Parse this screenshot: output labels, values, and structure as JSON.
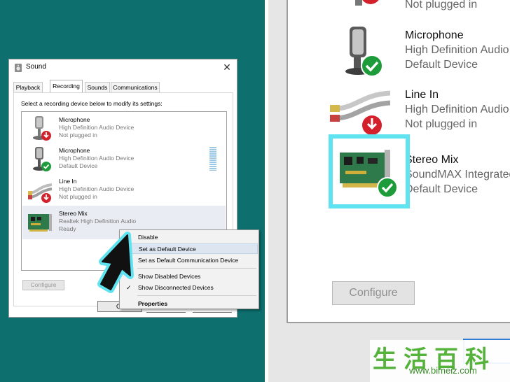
{
  "dialog": {
    "title": "Sound",
    "tabs": [
      "Playback",
      "Recording",
      "Sounds",
      "Communications"
    ],
    "active_tab": "Recording",
    "instruction": "Select a recording device below to modify its settings:",
    "devices": [
      {
        "name": "Microphone",
        "description": "High Definition Audio Device",
        "status": "Not plugged in",
        "badge": "down-arrow"
      },
      {
        "name": "Microphone",
        "description": "High Definition Audio Device",
        "status": "Default Device",
        "badge": "check"
      },
      {
        "name": "Line In",
        "description": "High Definition Audio Device",
        "status": "Not plugged in",
        "badge": "down-arrow"
      },
      {
        "name": "Stereo Mix",
        "description": "Realtek High Definition Audio",
        "status": "Ready",
        "badge": "none"
      }
    ],
    "configure_label": "Configure",
    "ok_label": "O"
  },
  "context_menu": {
    "items": [
      {
        "label": "Disable"
      },
      {
        "label": "Set as Default Device"
      },
      {
        "label": "Set as Default Communication Device"
      },
      {
        "label": "Show Disabled Devices"
      },
      {
        "label": "Show Disconnected Devices"
      },
      {
        "label": "Properties"
      }
    ],
    "check_glyph": "✓"
  },
  "zoom": {
    "rows": [
      {
        "name": "",
        "description": "",
        "status": "Not plugged in"
      },
      {
        "name": "Microphone",
        "description": "High Definition Audio",
        "status": "Default Device"
      },
      {
        "name": "Line In",
        "description": "High Definition Audio",
        "status": "Not plugged in"
      },
      {
        "name": "Stereo Mix",
        "description": "SoundMAX Integrated",
        "status": "Default Device"
      }
    ],
    "configure_label": "Configure"
  },
  "watermark": {
    "chinese": "生活百科",
    "url": "www.bimeiz.com"
  },
  "colors": {
    "background": "#0e6f6f",
    "highlight": "#5fe3f1",
    "check_green": "#1e9b3a",
    "arrow_red": "#d4202a"
  },
  "icons": {
    "title": "speaker-icon",
    "close": "close-icon",
    "microphone": "microphone-icon",
    "line_in": "audio-cable-icon",
    "stereo_mix": "sound-card-icon",
    "not_plugged": "red-down-arrow-icon",
    "default": "green-check-icon",
    "cursor": "mouse-pointer-icon"
  }
}
